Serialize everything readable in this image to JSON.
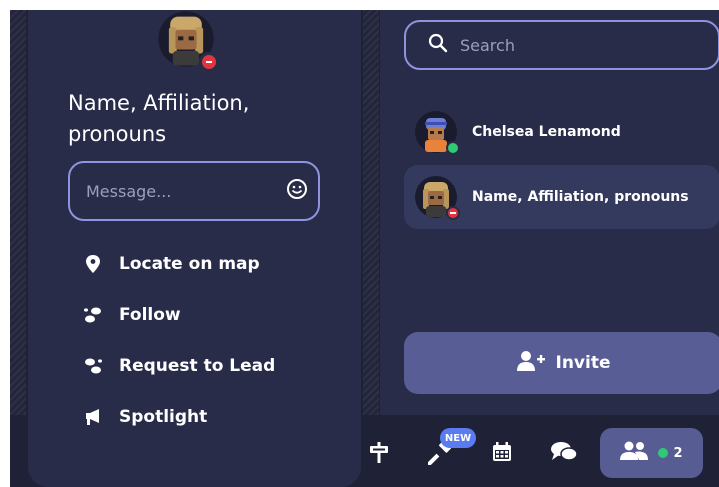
{
  "search": {
    "placeholder": "Search",
    "icon": "search-icon"
  },
  "players": [
    {
      "name": "Chelsea Lenamond",
      "status": "online",
      "status_color": "#2fca74"
    },
    {
      "name": "Name, Affiliation, pronouns",
      "status": "do-not-disturb",
      "status_color": "#e0343e"
    }
  ],
  "invite": {
    "label": "Invite",
    "icon": "add-user-icon"
  },
  "popup": {
    "name": "Name, Affiliation, pronouns",
    "message_placeholder": "Message...",
    "menu": [
      {
        "label": "Locate on map",
        "icon": "map-pin-icon"
      },
      {
        "label": "Follow",
        "icon": "footsteps-icon"
      },
      {
        "label": "Request to Lead",
        "icon": "footsteps-lead-icon"
      },
      {
        "label": "Spotlight",
        "icon": "megaphone-icon"
      }
    ]
  },
  "bottom_bar": {
    "new_badge": "NEW",
    "people_count": "2",
    "online_color": "#2fca74"
  },
  "colors": {
    "panel": "#282c48",
    "background": "#1f2237",
    "accent": "#8e94e0",
    "button": "#585e95"
  }
}
